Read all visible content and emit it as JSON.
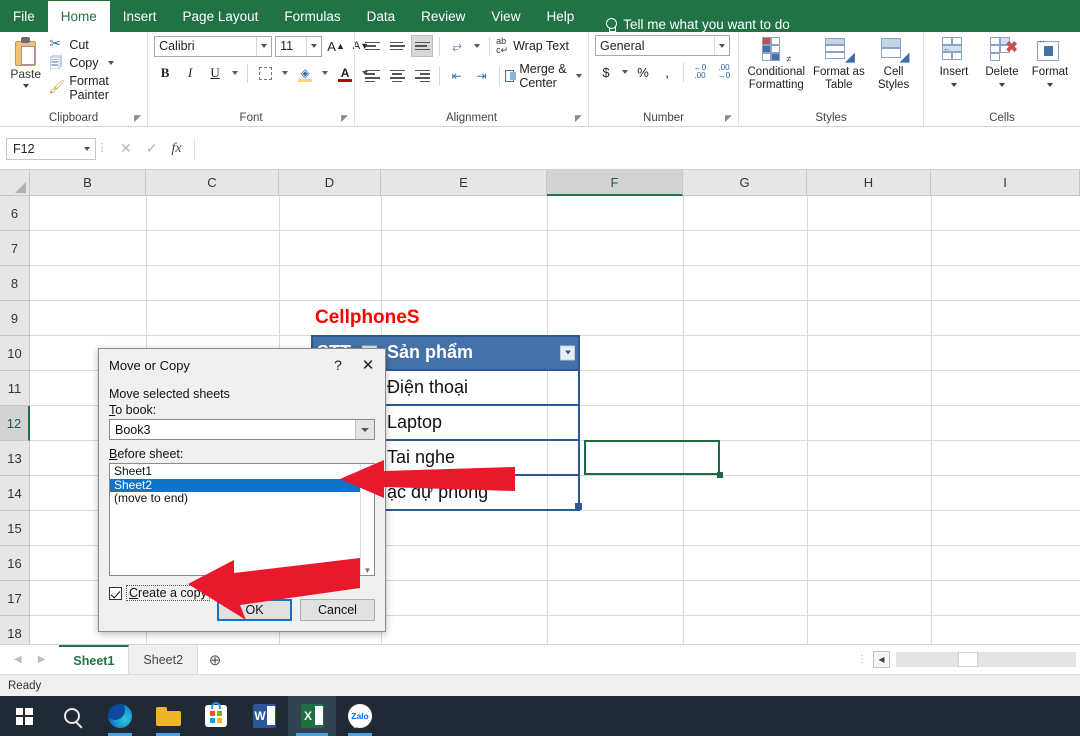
{
  "app": {
    "tabs": [
      {
        "label": "File",
        "active": false
      },
      {
        "label": "Home",
        "active": true
      },
      {
        "label": "Insert",
        "active": false
      },
      {
        "label": "Page Layout",
        "active": false
      },
      {
        "label": "Formulas",
        "active": false
      },
      {
        "label": "Data",
        "active": false
      },
      {
        "label": "Review",
        "active": false
      },
      {
        "label": "View",
        "active": false
      },
      {
        "label": "Help",
        "active": false
      }
    ],
    "tell_me": "Tell me what you want to do"
  },
  "ribbon": {
    "clipboard": {
      "group_label": "Clipboard",
      "paste": "Paste",
      "cut": "Cut",
      "copy": "Copy",
      "format_painter": "Format Painter"
    },
    "font": {
      "group_label": "Font",
      "font_name": "Calibri",
      "font_size": "11",
      "grow_font": "A",
      "shrink_font": "A",
      "bold": "B",
      "italic": "I",
      "underline": "U",
      "fill_color": "△",
      "font_color": "A"
    },
    "alignment": {
      "group_label": "Alignment",
      "wrap_text": "Wrap Text",
      "merge_center": "Merge & Center"
    },
    "number": {
      "group_label": "Number",
      "format": "General",
      "currency": "$",
      "percent": "%",
      "comma": ",",
      "increase_decimal": ".00",
      "decrease_decimal": ".00"
    },
    "styles": {
      "group_label": "Styles",
      "conditional_formatting": "Conditional Formatting",
      "format_as_table": "Format as Table",
      "cell_styles": "Cell Styles"
    },
    "cells": {
      "group_label": "Cells",
      "insert": "Insert",
      "delete": "Delete",
      "format": "Format"
    }
  },
  "formula_bar": {
    "name_box": "F12",
    "cancel_icon": "✕",
    "enter_icon": "✓",
    "fx": "fx",
    "value": ""
  },
  "grid": {
    "columns": [
      "B",
      "C",
      "D",
      "E",
      "F",
      "G",
      "H",
      "I"
    ],
    "selected_column": "F",
    "rows": [
      "6",
      "7",
      "8",
      "9",
      "10",
      "11",
      "12",
      "13",
      "14",
      "15",
      "16",
      "17",
      "18"
    ],
    "selected_row": "12",
    "title_cell": "CellphoneS",
    "table_headers": [
      "STT",
      "Sản phẩm"
    ],
    "table_rows": [
      "Điện thoại",
      "Laptop",
      "Tai nghe",
      "ạc dự phòng"
    ]
  },
  "dialog": {
    "title": "Move or Copy",
    "help_icon": "?",
    "close_icon": "✕",
    "subtitle": "Move selected sheets",
    "to_book_label": "To book:",
    "to_book_value": "Book3",
    "before_sheet_label": "Before sheet:",
    "sheet_list": [
      "Sheet1",
      "Sheet2",
      "(move to end)"
    ],
    "selected_sheet": "Sheet2",
    "create_copy_label": "Create a copy",
    "create_copy_checked": true,
    "ok": "OK",
    "cancel": "Cancel"
  },
  "sheet_tabs": {
    "prev_icon": "◀",
    "next_icon": "▶",
    "tabs": [
      {
        "label": "Sheet1",
        "active": true
      },
      {
        "label": "Sheet2",
        "active": false
      }
    ],
    "add_icon": "⊕"
  },
  "status_bar": {
    "text": "Ready"
  },
  "taskbar": {
    "items": [
      {
        "name": "start",
        "label": "Start"
      },
      {
        "name": "search",
        "label": "Search"
      },
      {
        "name": "edge",
        "label": "Microsoft Edge"
      },
      {
        "name": "file-explorer",
        "label": "File Explorer"
      },
      {
        "name": "store",
        "label": "Microsoft Store"
      },
      {
        "name": "word",
        "label": "W"
      },
      {
        "name": "excel",
        "label": "X"
      },
      {
        "name": "zalo",
        "label": "Zalo"
      }
    ]
  },
  "colors": {
    "excel_green": "#217346",
    "title_red": "#ff0000",
    "table_header_blue": "#4472a8",
    "selection_green": "#1e6b41",
    "list_select_blue": "#0f74c8",
    "arrow_red": "#e8192c"
  }
}
